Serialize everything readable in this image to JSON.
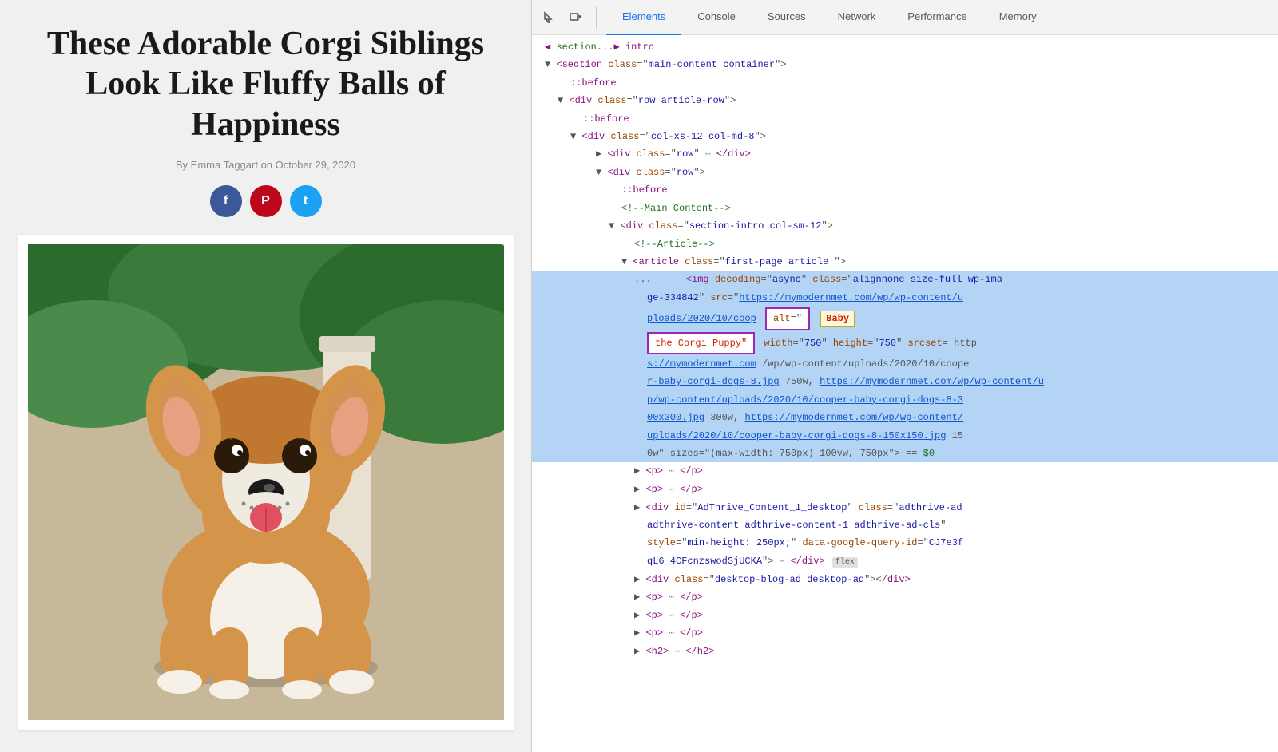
{
  "left": {
    "title": "These Adorable Corgi Siblings\nLook Like Fluffy Balls of\nHappiness",
    "meta": "By Emma Taggart on October 29, 2020",
    "social": {
      "facebook": "f",
      "pinterest": "P",
      "twitter": "t"
    }
  },
  "devtools": {
    "tabs": [
      "Elements",
      "Console",
      "Sources",
      "Network",
      "Performance",
      "Memory"
    ],
    "active_tab": "Elements",
    "dom_lines": [
      {
        "indent": 0,
        "content": "section_intro",
        "type": "comment_section"
      },
      {
        "indent": 0,
        "content": "section_main",
        "type": "open_tag"
      },
      {
        "indent": 1,
        "content": "::before",
        "type": "pseudo"
      },
      {
        "indent": 1,
        "content": "div_row_article",
        "type": "open_tag"
      },
      {
        "indent": 2,
        "content": "::before",
        "type": "pseudo"
      },
      {
        "indent": 2,
        "content": "div_col",
        "type": "open_tag"
      },
      {
        "indent": 3,
        "content": "div_row_ellipsis",
        "type": "collapsed"
      },
      {
        "indent": 3,
        "content": "div_row_open",
        "type": "open_tag"
      },
      {
        "indent": 4,
        "content": "::before",
        "type": "pseudo"
      },
      {
        "indent": 4,
        "content": "comment_main",
        "type": "comment"
      },
      {
        "indent": 4,
        "content": "div_section_intro",
        "type": "open_tag"
      },
      {
        "indent": 5,
        "content": "comment_article",
        "type": "comment"
      },
      {
        "indent": 5,
        "content": "article_first_page",
        "type": "open_tag"
      },
      {
        "indent": 6,
        "content": "img_line",
        "type": "img_highlighted"
      },
      {
        "indent": 6,
        "content": "img_src_line",
        "type": "img_src"
      },
      {
        "indent": 6,
        "content": "img_attr_line",
        "type": "img_attr_tooltip"
      },
      {
        "indent": 6,
        "content": "img_srcset",
        "type": "img_srcset"
      },
      {
        "indent": 6,
        "content": "img_srcset2",
        "type": "img_srcset2"
      },
      {
        "indent": 6,
        "content": "img_srcset3",
        "type": "img_srcset3"
      },
      {
        "indent": 6,
        "content": "img_end",
        "type": "img_end"
      },
      {
        "indent": 5,
        "content": "p1",
        "type": "p_tag"
      },
      {
        "indent": 5,
        "content": "p2",
        "type": "p_tag"
      },
      {
        "indent": 5,
        "content": "div_adthrive",
        "type": "div_adthrive"
      },
      {
        "indent": 6,
        "content": "adthrive_style",
        "type": "adthrive_style"
      },
      {
        "indent": 6,
        "content": "adthrive_end",
        "type": "adthrive_end"
      },
      {
        "indent": 5,
        "content": "div_desktop_ad",
        "type": "div_desktop"
      },
      {
        "indent": 5,
        "content": "p3",
        "type": "p_tag"
      },
      {
        "indent": 5,
        "content": "p4",
        "type": "p_tag"
      },
      {
        "indent": 5,
        "content": "p5",
        "type": "p_tag"
      },
      {
        "indent": 5,
        "content": "h2",
        "type": "h2_tag"
      }
    ]
  }
}
